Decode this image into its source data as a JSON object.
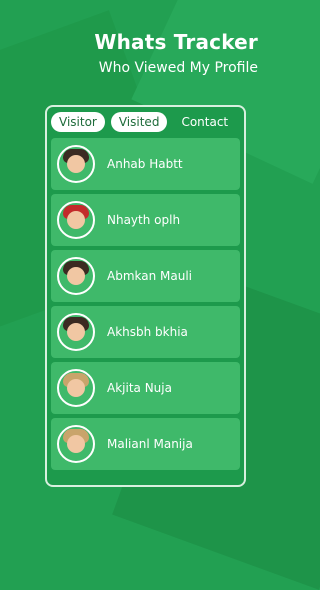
{
  "header": {
    "title": "Whats Tracker",
    "subtitle": "Who Viewed My Profile"
  },
  "tabs": [
    {
      "label": "Visitor"
    },
    {
      "label": "Visited"
    },
    {
      "label": "Contact"
    }
  ],
  "profiles": [
    {
      "name": "Anhab Habtt"
    },
    {
      "name": "Nhayth oplh"
    },
    {
      "name": "Abmkan Mauli"
    },
    {
      "name": "Akhsbh bkhia"
    },
    {
      "name": "Akjita Nuja"
    },
    {
      "name": "Malianl Manija"
    }
  ],
  "colors": {
    "background": "#22a052",
    "card": "#3fb96a",
    "accent": "#ffffff"
  }
}
